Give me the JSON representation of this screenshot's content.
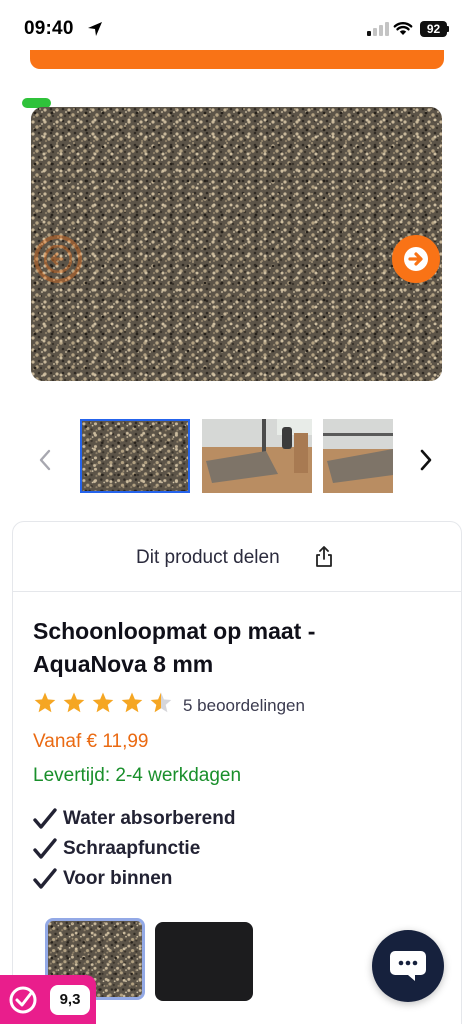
{
  "status_bar": {
    "time": "09:40",
    "battery": "92"
  },
  "product": {
    "title": "Schoonloopmat op maat - AquaNova 8 mm",
    "rating": 4.5,
    "reviews": "5 beoordelingen",
    "price": "Vanaf € 11,99",
    "delivery": "Levertijd: 2-4 werkdagen",
    "features": [
      "Water absorberend",
      "Schraapfunctie",
      "Voor binnen"
    ]
  },
  "share": {
    "label": "Dit product delen"
  },
  "rating_badge": {
    "score": "9,3"
  },
  "colors": {
    "accent": "#f97316",
    "price": "#ea6a12",
    "delivery": "#198f2b",
    "rating_badge": "#e91e8c",
    "chat": "#16213d",
    "star": "#f5a623"
  },
  "icons": [
    "location-arrow-icon",
    "signal-icon",
    "wifi-icon",
    "arrow-left-icon",
    "arrow-right-icon",
    "chevron-left-icon",
    "chevron-right-icon",
    "share-icon",
    "star-icon",
    "checkmark-icon",
    "chat-icon"
  ]
}
